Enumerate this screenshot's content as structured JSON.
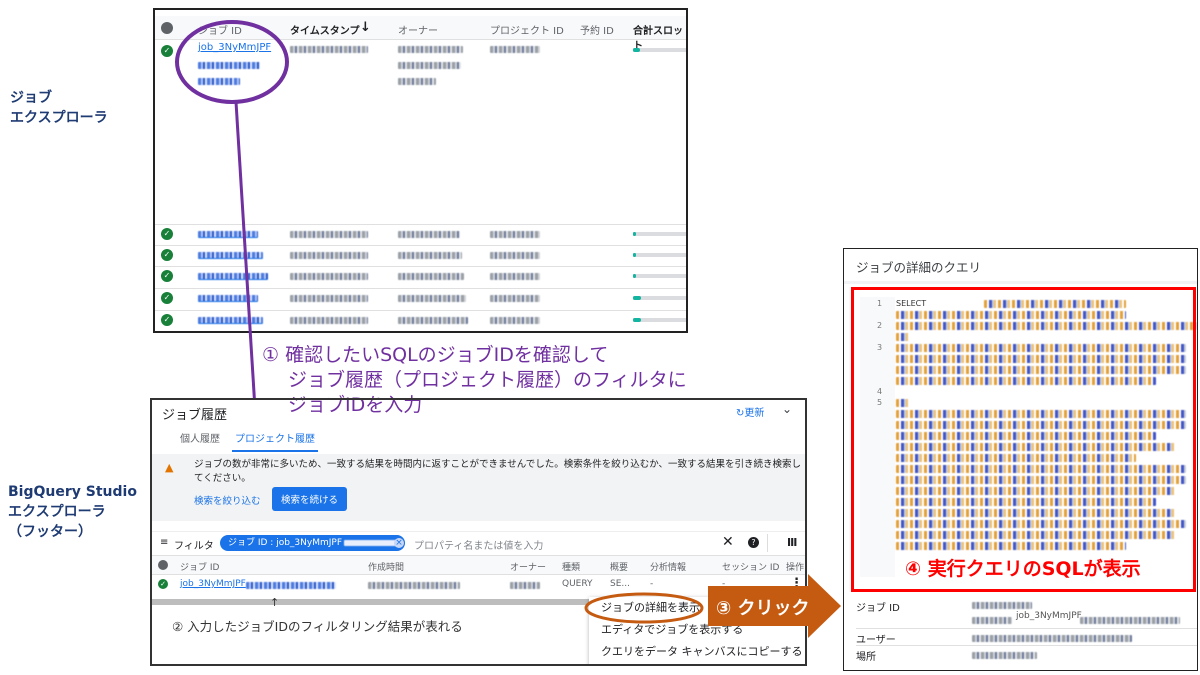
{
  "labels": {
    "job_explorer": [
      "ジョブ",
      "エクスプローラ"
    ],
    "studio_explorer": [
      "BigQuery Studio",
      "エクスプローラ",
      "（フッター）"
    ]
  },
  "job_explorer": {
    "columns": [
      "ジョブ ID",
      "タイムスタンプ",
      "オーナー",
      "プロジェクト ID",
      "予約 ID",
      "合計スロット"
    ],
    "sort_icon": "arrow-down-icon",
    "first_job_id": "job_3NyMmJPF",
    "slot_fills": [
      0.12,
      0.05,
      0.05,
      0.05,
      0.15,
      0.15
    ]
  },
  "annotations": {
    "step1": [
      "① 確認したいSQLのジョブIDを確認して",
      "ジョブ履歴（プロジェクト履歴）のフィルタに",
      "ジョブIDを入力"
    ],
    "step2": "② 入力したジョブIDのフィルタリング結果が表れる",
    "step3": "③ クリック",
    "step4": "④ 実行クエリのSQLが表示"
  },
  "job_history": {
    "title": "ジョブ履歴",
    "refresh": "更新",
    "tabs": [
      {
        "label": "個人履歴",
        "active": false
      },
      {
        "label": "プロジェクト履歴",
        "active": true
      }
    ],
    "warning": "ジョブの数が非常に多いため、一致する結果を時間内に返すことができませんでした。検索条件を絞り込むか、一致する結果を引き続き検索してください。",
    "narrow_link": "検索を絞り込む",
    "continue_button": "検索を続ける",
    "filter_label": "フィルタ",
    "chip": "ジョブ ID : job_3NyMmJPF",
    "filter_placeholder": "プロパティ名または値を入力",
    "columns": [
      "ジョブ ID",
      "作成時間",
      "オーナー",
      "種類",
      "概要",
      "分析情報",
      "セッション ID",
      "操作"
    ],
    "row": {
      "job_id": "job_3NyMmJPF",
      "type": "QUERY",
      "summary": "SE...",
      "insight": "-",
      "session": "-"
    },
    "menu": [
      "ジョブの詳細を表示",
      "エディタでジョブを表示する",
      "クエリをデータ キャンバスにコピーする"
    ]
  },
  "details": {
    "title": "ジョブの詳細のクエリ",
    "line_numbers": [
      "1",
      "2",
      "3",
      "4",
      "5"
    ],
    "first_keyword": "SELECT",
    "fields": [
      {
        "label": "ジョブ ID",
        "value": "job_3NyMmJPF"
      },
      {
        "label": "ユーザー"
      },
      {
        "label": "場所"
      }
    ]
  },
  "colors": {
    "purple": "#7030a0",
    "orange": "#c55a11",
    "red": "#ff0000",
    "navy": "#1f3b73",
    "blue": "#1a73e8"
  }
}
